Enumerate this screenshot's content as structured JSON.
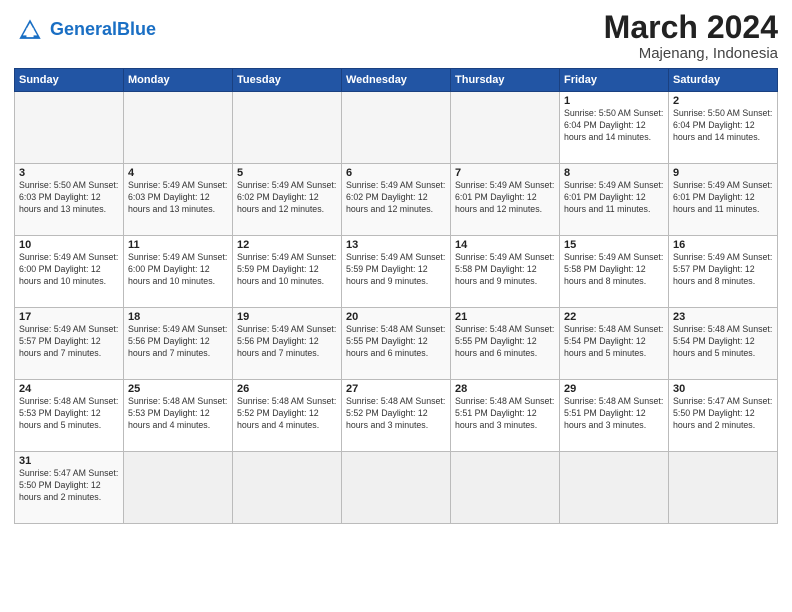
{
  "header": {
    "logo_general": "General",
    "logo_blue": "Blue",
    "title": "March 2024",
    "subtitle": "Majenang, Indonesia"
  },
  "days_of_week": [
    "Sunday",
    "Monday",
    "Tuesday",
    "Wednesday",
    "Thursday",
    "Friday",
    "Saturday"
  ],
  "weeks": [
    [
      {
        "day": "",
        "info": ""
      },
      {
        "day": "",
        "info": ""
      },
      {
        "day": "",
        "info": ""
      },
      {
        "day": "",
        "info": ""
      },
      {
        "day": "",
        "info": ""
      },
      {
        "day": "1",
        "info": "Sunrise: 5:50 AM\nSunset: 6:04 PM\nDaylight: 12 hours\nand 14 minutes."
      },
      {
        "day": "2",
        "info": "Sunrise: 5:50 AM\nSunset: 6:04 PM\nDaylight: 12 hours\nand 14 minutes."
      }
    ],
    [
      {
        "day": "3",
        "info": "Sunrise: 5:50 AM\nSunset: 6:03 PM\nDaylight: 12 hours\nand 13 minutes."
      },
      {
        "day": "4",
        "info": "Sunrise: 5:49 AM\nSunset: 6:03 PM\nDaylight: 12 hours\nand 13 minutes."
      },
      {
        "day": "5",
        "info": "Sunrise: 5:49 AM\nSunset: 6:02 PM\nDaylight: 12 hours\nand 12 minutes."
      },
      {
        "day": "6",
        "info": "Sunrise: 5:49 AM\nSunset: 6:02 PM\nDaylight: 12 hours\nand 12 minutes."
      },
      {
        "day": "7",
        "info": "Sunrise: 5:49 AM\nSunset: 6:01 PM\nDaylight: 12 hours\nand 12 minutes."
      },
      {
        "day": "8",
        "info": "Sunrise: 5:49 AM\nSunset: 6:01 PM\nDaylight: 12 hours\nand 11 minutes."
      },
      {
        "day": "9",
        "info": "Sunrise: 5:49 AM\nSunset: 6:01 PM\nDaylight: 12 hours\nand 11 minutes."
      }
    ],
    [
      {
        "day": "10",
        "info": "Sunrise: 5:49 AM\nSunset: 6:00 PM\nDaylight: 12 hours\nand 10 minutes."
      },
      {
        "day": "11",
        "info": "Sunrise: 5:49 AM\nSunset: 6:00 PM\nDaylight: 12 hours\nand 10 minutes."
      },
      {
        "day": "12",
        "info": "Sunrise: 5:49 AM\nSunset: 5:59 PM\nDaylight: 12 hours\nand 10 minutes."
      },
      {
        "day": "13",
        "info": "Sunrise: 5:49 AM\nSunset: 5:59 PM\nDaylight: 12 hours\nand 9 minutes."
      },
      {
        "day": "14",
        "info": "Sunrise: 5:49 AM\nSunset: 5:58 PM\nDaylight: 12 hours\nand 9 minutes."
      },
      {
        "day": "15",
        "info": "Sunrise: 5:49 AM\nSunset: 5:58 PM\nDaylight: 12 hours\nand 8 minutes."
      },
      {
        "day": "16",
        "info": "Sunrise: 5:49 AM\nSunset: 5:57 PM\nDaylight: 12 hours\nand 8 minutes."
      }
    ],
    [
      {
        "day": "17",
        "info": "Sunrise: 5:49 AM\nSunset: 5:57 PM\nDaylight: 12 hours\nand 7 minutes."
      },
      {
        "day": "18",
        "info": "Sunrise: 5:49 AM\nSunset: 5:56 PM\nDaylight: 12 hours\nand 7 minutes."
      },
      {
        "day": "19",
        "info": "Sunrise: 5:49 AM\nSunset: 5:56 PM\nDaylight: 12 hours\nand 7 minutes."
      },
      {
        "day": "20",
        "info": "Sunrise: 5:48 AM\nSunset: 5:55 PM\nDaylight: 12 hours\nand 6 minutes."
      },
      {
        "day": "21",
        "info": "Sunrise: 5:48 AM\nSunset: 5:55 PM\nDaylight: 12 hours\nand 6 minutes."
      },
      {
        "day": "22",
        "info": "Sunrise: 5:48 AM\nSunset: 5:54 PM\nDaylight: 12 hours\nand 5 minutes."
      },
      {
        "day": "23",
        "info": "Sunrise: 5:48 AM\nSunset: 5:54 PM\nDaylight: 12 hours\nand 5 minutes."
      }
    ],
    [
      {
        "day": "24",
        "info": "Sunrise: 5:48 AM\nSunset: 5:53 PM\nDaylight: 12 hours\nand 5 minutes."
      },
      {
        "day": "25",
        "info": "Sunrise: 5:48 AM\nSunset: 5:53 PM\nDaylight: 12 hours\nand 4 minutes."
      },
      {
        "day": "26",
        "info": "Sunrise: 5:48 AM\nSunset: 5:52 PM\nDaylight: 12 hours\nand 4 minutes."
      },
      {
        "day": "27",
        "info": "Sunrise: 5:48 AM\nSunset: 5:52 PM\nDaylight: 12 hours\nand 3 minutes."
      },
      {
        "day": "28",
        "info": "Sunrise: 5:48 AM\nSunset: 5:51 PM\nDaylight: 12 hours\nand 3 minutes."
      },
      {
        "day": "29",
        "info": "Sunrise: 5:48 AM\nSunset: 5:51 PM\nDaylight: 12 hours\nand 3 minutes."
      },
      {
        "day": "30",
        "info": "Sunrise: 5:47 AM\nSunset: 5:50 PM\nDaylight: 12 hours\nand 2 minutes."
      }
    ],
    [
      {
        "day": "31",
        "info": "Sunrise: 5:47 AM\nSunset: 5:50 PM\nDaylight: 12 hours\nand 2 minutes."
      },
      {
        "day": "",
        "info": ""
      },
      {
        "day": "",
        "info": ""
      },
      {
        "day": "",
        "info": ""
      },
      {
        "day": "",
        "info": ""
      },
      {
        "day": "",
        "info": ""
      },
      {
        "day": "",
        "info": ""
      }
    ]
  ]
}
